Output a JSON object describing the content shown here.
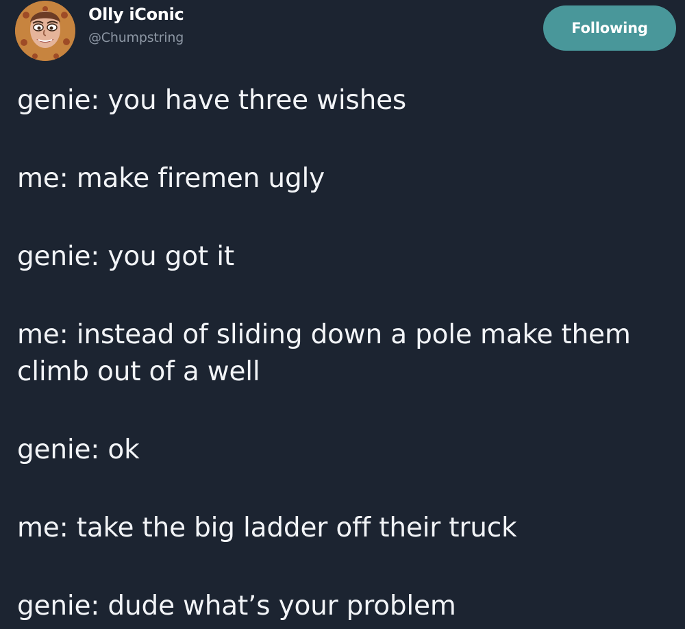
{
  "tweet": {
    "author": {
      "display_name": "Olly iConic",
      "handle": "@Chumpstring",
      "avatar_icon": "cartoon-face-avatar"
    },
    "follow_button_label": "Following",
    "lines": [
      "genie: you have three wishes",
      "me: make firemen ugly",
      "genie: you got it",
      "me: instead of sliding down a pole make them climb out of a well",
      "genie: ok",
      "me: take the big ladder off their truck",
      "genie: dude what’s your problem"
    ]
  },
  "colors": {
    "background": "#1c2431",
    "text": "#f2f4f7",
    "handle": "#8d97a4",
    "follow_button": "#49979a"
  }
}
